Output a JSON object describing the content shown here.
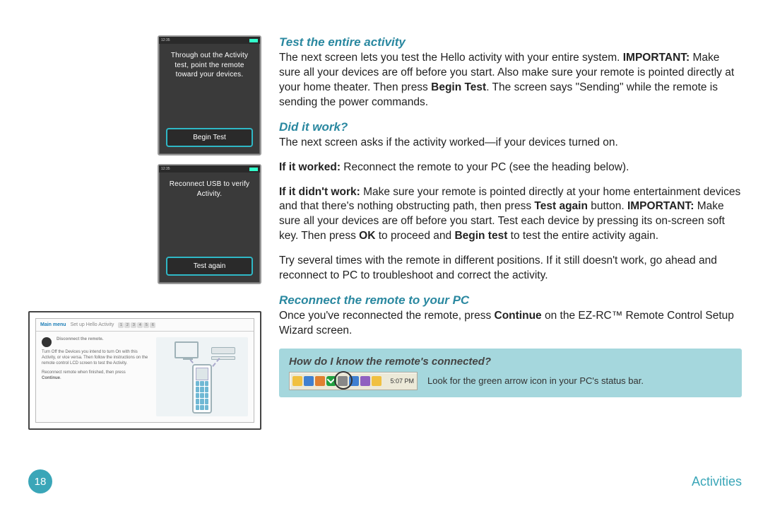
{
  "sections": {
    "test_activity": {
      "heading": "Test the entire activity",
      "para1_a": "The next screen lets you test the Hello activity with your entire system.",
      "para1_b": "IMPORTANT:",
      "para1_c": " Make sure all your devices are off before you start. Also make sure your remote is pointed directly at your home theater. Then press ",
      "para1_d": "Begin Test",
      "para1_e": ". The screen says \"Sending\" while the remote is sending the power commands."
    },
    "did_it_work": {
      "heading": "Did it work?",
      "p1": "The next screen asks if the activity worked—if your devices turned on.",
      "p2_a": "If it worked:",
      "p2_b": " Reconnect the remote to your PC (see the heading below).",
      "p3_a": "If it didn't work:",
      "p3_b": " Make sure your remote is pointed directly at your home entertainment devices and that there's nothing obstructing path, then press ",
      "p3_c": "Test again",
      "p3_d": " button. ",
      "p3_e": "IMPORTANT:",
      "p3_f": " Make sure all your devices are off before you start. Test each device by pressing its on-screen soft key. Then press ",
      "p3_g": "OK",
      "p3_h": " to proceed and ",
      "p3_i": "Begin test",
      "p3_j": " to test the entire activity again.",
      "p4": "Try several times with the remote in different positions. If it still doesn't work, go ahead and reconnect to PC to troubleshoot and correct the activity."
    },
    "reconnect": {
      "heading": "Reconnect the remote to your PC",
      "p1_a": "Once you've reconnected the remote, press ",
      "p1_b": "Continue",
      "p1_c": " on the EZ-RC™ Remote Control Setup Wizard screen."
    },
    "callout": {
      "heading": "How do I know the remote's connected?",
      "note": "Look for the green arrow icon in your PC's status bar.",
      "tray_time": "5:07 PM"
    }
  },
  "remote_screens": {
    "s1": {
      "time": "12:35",
      "text": "Through out the Activity test, point the remote toward your devices.",
      "button": "Begin Test"
    },
    "s2": {
      "time": "12:35",
      "text": "Reconnect USB to verify Activity.",
      "button": "Test again"
    }
  },
  "wizard": {
    "main_menu": "Main menu",
    "breadcrumb": "Set up Hello Activity",
    "sub": "Disconnect the remote.",
    "body": "Turn Off the Devices you intend to turn On with this Activity, or vice versa. Then follow the instructions on the remote control LCD screen to test the Activity.",
    "body2": "Reconnect remote when finished, then press",
    "body3": "Continue"
  },
  "footer": {
    "page": "18",
    "section": "Activities"
  }
}
